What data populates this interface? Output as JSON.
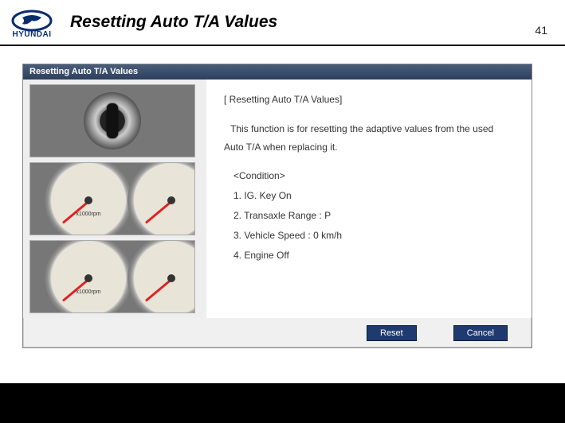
{
  "header": {
    "brand": "HYUNDAI",
    "title": "Resetting Auto T/A Values",
    "page_number": "41"
  },
  "dialog": {
    "title": "Resetting Auto T/A Values",
    "section_title": "[ Resetting Auto T/A Values]",
    "description": "This function is for resetting the adaptive values from the used Auto T/A when replacing it.",
    "condition_heading": "<Condition>",
    "conditions": [
      "1. IG. Key On",
      "2. Transaxle Range : P",
      "3. Vehicle Speed : 0 km/h",
      "4. Engine Off"
    ],
    "gauge_label": "x1000rpm",
    "buttons": {
      "reset": "Reset",
      "cancel": "Cancel"
    }
  }
}
